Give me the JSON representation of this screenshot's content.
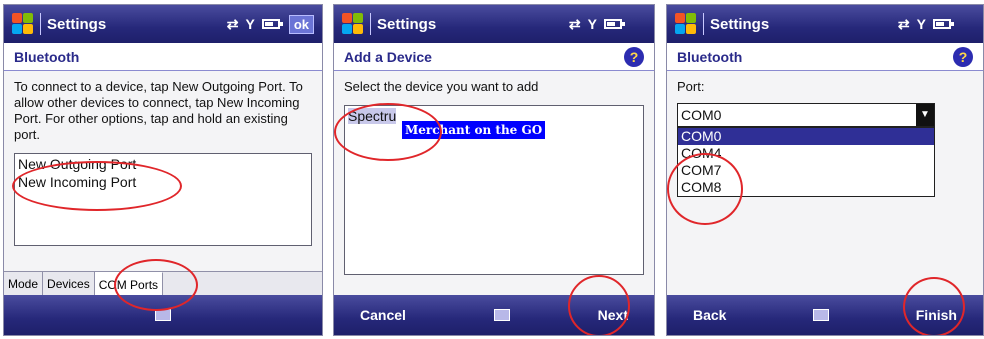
{
  "screens": [
    {
      "title": "Settings",
      "ok_label": "ok",
      "header": "Bluetooth",
      "instructions": "To connect to a device, tap New Outgoing Port. To allow other devices to connect, tap New Incoming Port. For other options, tap and hold an existing port.",
      "ports": [
        "New Outgoing Port",
        "New Incoming Port"
      ],
      "tabs": [
        "Mode",
        "Devices",
        "COM Ports"
      ]
    },
    {
      "title": "Settings",
      "header": "Add a Device",
      "help": "?",
      "prompt": "Select the device you want to add",
      "device": "Spectru",
      "overlay": "Merchant on the GO",
      "left_soft": "Cancel",
      "right_soft": "Next"
    },
    {
      "title": "Settings",
      "header": "Bluetooth",
      "help": "?",
      "port_label": "Port:",
      "selected_port": "COM0",
      "options": [
        "COM0",
        "COM4",
        "COM7",
        "COM8"
      ],
      "left_soft": "Back",
      "right_soft": "Finish"
    }
  ],
  "colors": {
    "titlebar": "#26287a",
    "highlight": "#e0262a",
    "overlay": "#0000ff"
  }
}
